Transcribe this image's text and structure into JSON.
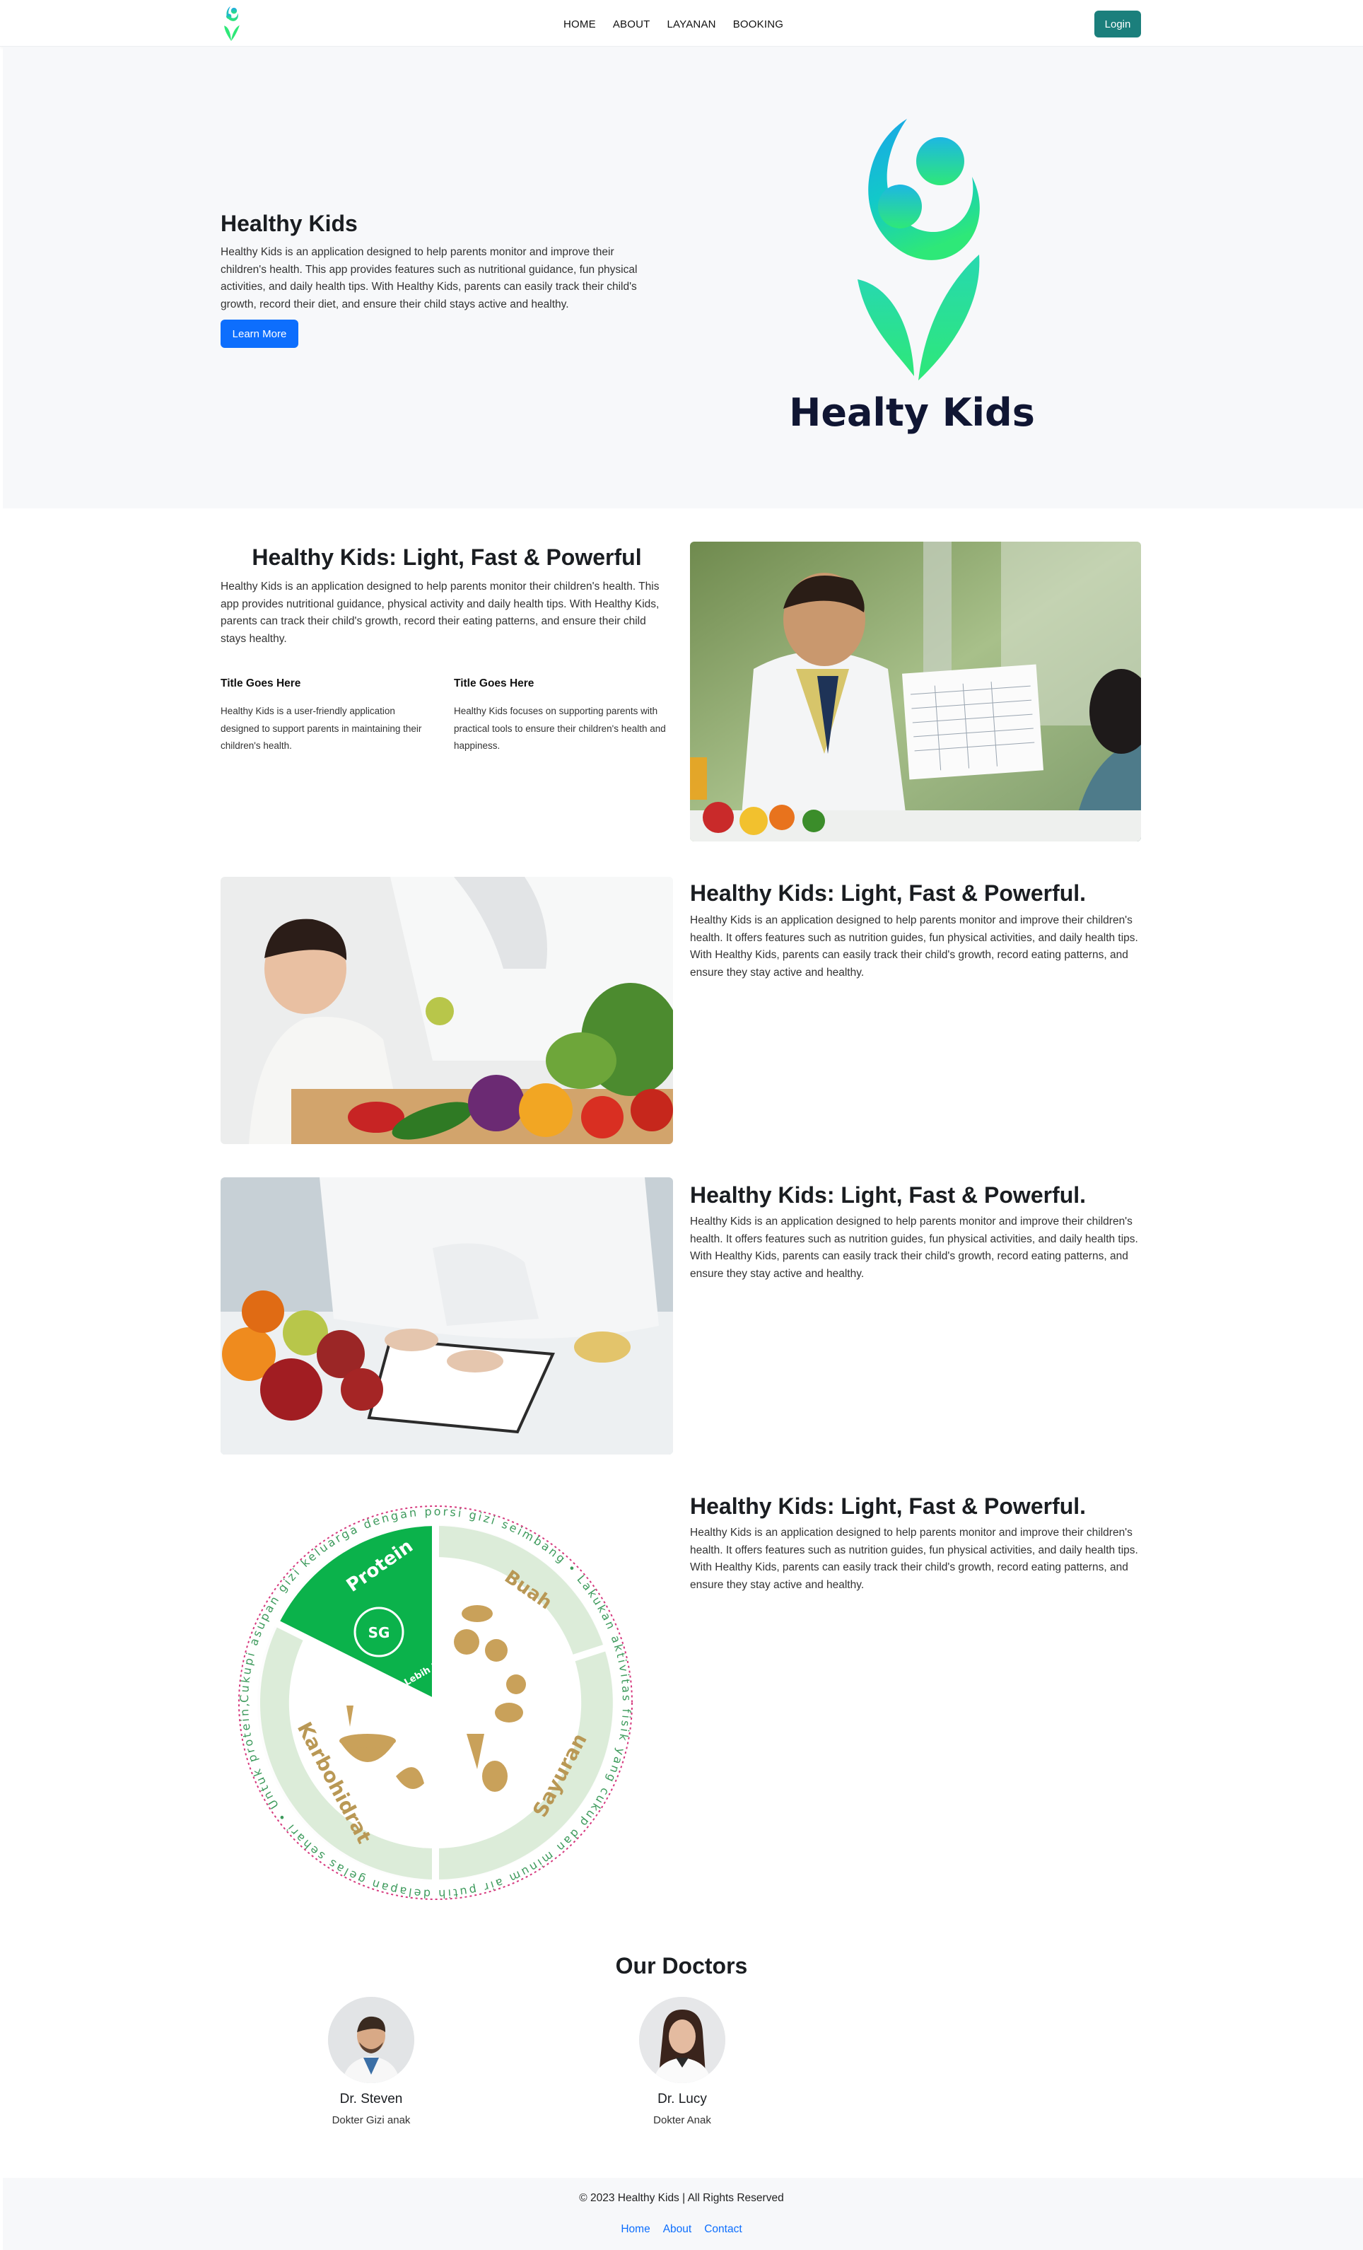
{
  "nav": {
    "links": [
      "HOME",
      "ABOUT",
      "LAYANAN",
      "BOOKING"
    ],
    "login_label": "Login"
  },
  "hero": {
    "title": "Healthy Kids",
    "text": "Healthy Kids is an application designed to help parents monitor and improve their children's health. This app provides features such as nutritional guidance, fun physical activities, and daily health tips. With Healthy Kids, parents can easily track their child's growth, record their diet, and ensure their child stays active and healthy.",
    "button": "Learn More",
    "logo_wordmark": "Healty Kids"
  },
  "intro": {
    "title": "Healthy Kids: Light, Fast & Powerful",
    "text": "Healthy Kids is an application designed to help parents monitor their children's health. This app provides nutritional guidance, physical activity and daily health tips. With Healthy Kids, parents can track their child's growth, record their eating patterns, and ensure their child stays healthy.",
    "features": [
      {
        "title": "Title Goes Here",
        "text": "Healthy Kids is a user-friendly application designed to support parents in maintaining their children's health."
      },
      {
        "title": "Title Goes Here",
        "text": "Healthy Kids focuses on supporting parents with practical tools to ensure their children's health and happiness."
      }
    ]
  },
  "rows": [
    {
      "title": "Healthy Kids: Light, Fast & Powerful.",
      "text": "Healthy Kids is an application designed to help parents monitor and improve their children's health. It offers features such as nutrition guides, fun physical activities, and daily health tips. With Healthy Kids, parents can easily track their child's growth, record eating patterns, and ensure they stay active and healthy."
    },
    {
      "title": "Healthy Kids: Light, Fast & Powerful.",
      "text": "Healthy Kids is an application designed to help parents monitor and improve their children's health. It offers features such as nutrition guides, fun physical activities, and daily health tips. With Healthy Kids, parents can easily track their child's growth, record eating patterns, and ensure they stay active and healthy."
    },
    {
      "title": "Healthy Kids: Light, Fast & Powerful.",
      "text": "Healthy Kids is an application designed to help parents monitor and improve their children's health. It offers features such as nutrition guides, fun physical activities, and daily health tips. With Healthy Kids, parents can easily track their child's growth, record eating patterns, and ensure they stay active and healthy."
    }
  ],
  "plate": {
    "segments": [
      "Protein",
      "Buah",
      "Sayuran",
      "Karbohidrat"
    ],
    "ring_text": "Cukupi asupan gizi keluarga dengan porsi gizi seimbang • Lakukan aktivitas fisik yang cukup dan minum air putih delapan gelas sehari • Untuk protein, #LebihBaikSeGood •",
    "badge": "SG",
    "badge_caption": "Lebih Baik SeGood"
  },
  "doctors": {
    "title": "Our Doctors",
    "list": [
      {
        "name": "Dr. Steven",
        "role": "Dokter Gizi anak"
      },
      {
        "name": "Dr. Lucy",
        "role": "Dokter Anak"
      }
    ]
  },
  "footer": {
    "copyright": "© 2023 Healthy Kids | All Rights Reserved",
    "links": [
      "Home",
      "About",
      "Contact"
    ]
  },
  "colors": {
    "primary": "#0d6efd",
    "login": "#1b7f7c",
    "logo_blue": "#1aa6e8",
    "logo_green": "#2ee878",
    "wordmark": "#101633"
  }
}
